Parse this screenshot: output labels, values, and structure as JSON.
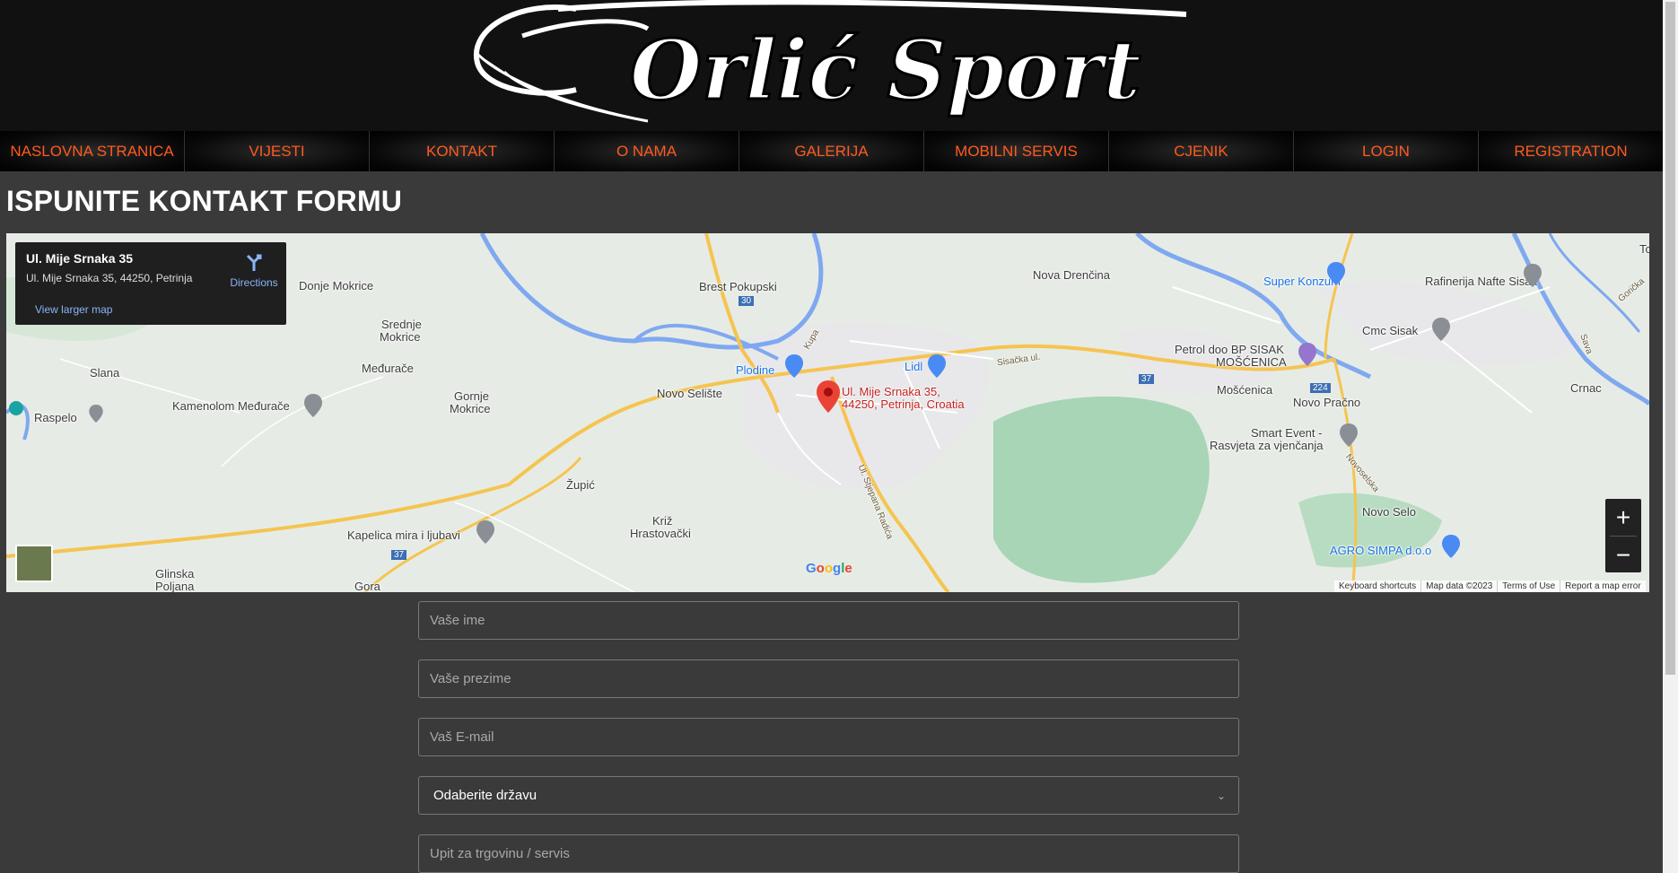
{
  "brand": {
    "logo_text": "Orlić Sport"
  },
  "nav": {
    "items": [
      {
        "label": "NASLOVNA STRANICA"
      },
      {
        "label": "VIJESTI"
      },
      {
        "label": "KONTAKT"
      },
      {
        "label": "O NAMA"
      },
      {
        "label": "GALERIJA"
      },
      {
        "label": "MOBILNI SERVIS"
      },
      {
        "label": "CJENIK"
      },
      {
        "label": "LOGIN"
      },
      {
        "label": "REGISTRATION"
      }
    ]
  },
  "page": {
    "title": "ISPUNITE KONTAKT FORMU"
  },
  "map": {
    "card": {
      "title": "Ul. Mije Srnaka 35",
      "address": "Ul. Mije Srnaka 35, 44250, Petrinja",
      "larger_map": "View larger map",
      "directions": "Directions"
    },
    "pin_label_line1": "Ul. Mije Srnaka 35,",
    "pin_label_line2": "44250, Petrinja, Croatia",
    "places": {
      "donje_mokrice": "Donje Mokrice",
      "brest": "Brest Pokupski",
      "nova_drencina": "Nova Drenčina",
      "super_konzum": "Super Konzum",
      "rafinerija": "Rafinerija Nafte Sisak",
      "to": "To",
      "srednje": "Srednje",
      "mokrice": "Mokrice",
      "medurace": "Međurače",
      "slana": "Slana",
      "raspelo": "Raspelo",
      "kamenolom": "Kamenolom Međurače",
      "gornje": "Gornje",
      "gornje_mokrice": "Mokrice",
      "novo_seliste": "Novo Selište",
      "plodine": "Plodine",
      "lidl": "Lidl",
      "kupa": "Kupa",
      "sisacka": "Sisačka ul.",
      "petrol": "Petrol doo BP SISAK",
      "moscenica_caps": "MOŠĆENICA",
      "moscenica": "Mošćenica",
      "novo_pracno": "Novo Pračno",
      "cmc": "Cmc Sisak",
      "crnac": "Crnac",
      "sava": "Sava",
      "gorica": "Gorička",
      "smart": "Smart Event -",
      "rasvjeta": "Rasvjeta za vjenčanja",
      "zupic": "Župić",
      "kriz": "Križ",
      "hrastovacki": "Hrastovački",
      "kapelica": "Kapelica mira i ljubavi",
      "stjepana": "Ul. Stjepana Radića",
      "novoselska": "Novoselska",
      "novo_selo": "Novo Selo",
      "agro": "AGRO SIMPA d.o.o",
      "glinska": "Glinska",
      "poljana": "Poljana",
      "gora": "Gora",
      "r30": "30",
      "r37a": "37",
      "r37b": "37",
      "r224": "224"
    },
    "google": "Google",
    "attribution": [
      "Keyboard shortcuts",
      "Map data ©2023",
      "Terms of Use",
      "Report a map error"
    ],
    "zoom_in": "+",
    "zoom_out": "−"
  },
  "form": {
    "first_name_placeholder": "Vaše ime",
    "last_name_placeholder": "Vaše prezime",
    "email_placeholder": "Vaš E-mail",
    "country_selected": "Odaberite državu",
    "inquiry_placeholder": "Upit za trgovinu / servis"
  },
  "colors": {
    "accent": "#ff5a1f",
    "background": "#3a3a3a",
    "header": "#111111"
  }
}
